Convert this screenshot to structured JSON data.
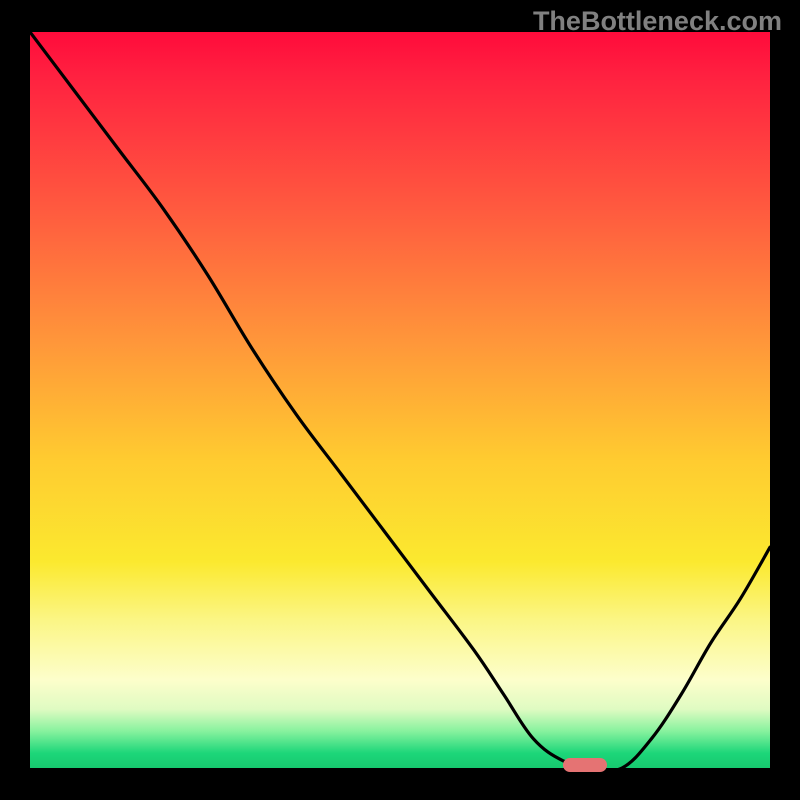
{
  "watermark": "TheBottleneck.com",
  "chart_data": {
    "type": "line",
    "title": "",
    "xlabel": "",
    "ylabel": "",
    "xlim": [
      0,
      100
    ],
    "ylim": [
      0,
      100
    ],
    "grid": false,
    "x": [
      0,
      6,
      12,
      18,
      24,
      30,
      36,
      42,
      48,
      54,
      60,
      64,
      68,
      72,
      76,
      80,
      84,
      88,
      92,
      96,
      100
    ],
    "y": [
      100,
      92,
      84,
      76,
      67,
      57,
      48,
      40,
      32,
      24,
      16,
      10,
      4,
      1,
      0,
      0,
      4,
      10,
      17,
      23,
      30
    ],
    "marker": {
      "x_start": 72,
      "x_end": 78,
      "y": 0
    },
    "background_gradient": {
      "stops": [
        {
          "pos": 0,
          "color": "#ff0b3b"
        },
        {
          "pos": 24,
          "color": "#ff5a3f"
        },
        {
          "pos": 58,
          "color": "#ffcb30"
        },
        {
          "pos": 80,
          "color": "#fbf686"
        },
        {
          "pos": 95,
          "color": "#87f29e"
        },
        {
          "pos": 100,
          "color": "#17c96f"
        }
      ]
    }
  }
}
